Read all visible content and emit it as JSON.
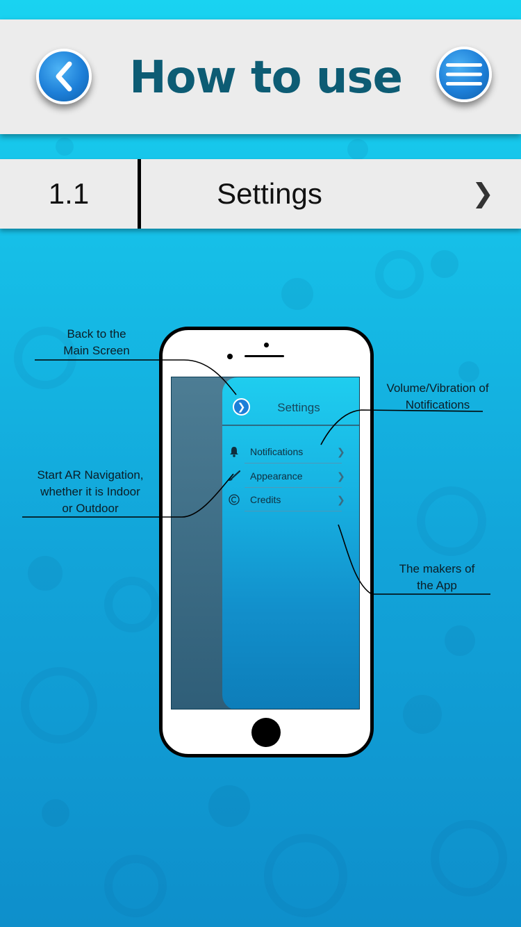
{
  "header": {
    "title": "How to use",
    "back_icon": "chevron-left-icon",
    "menu_icon": "hamburger-menu-icon"
  },
  "section": {
    "number": "1.1",
    "title": "Settings",
    "chevron": "❯"
  },
  "phone_screen": {
    "back_glyph": "❯",
    "title": "Settings",
    "items": [
      {
        "label": "Notifications",
        "icon": "bell-icon",
        "chevron": "❯"
      },
      {
        "label": "Appearance",
        "icon": "brush-icon",
        "chevron": "❯"
      },
      {
        "label": "Credits",
        "icon": "copyright-icon",
        "chevron": "❯"
      }
    ]
  },
  "callouts": {
    "back": [
      "Back to the",
      "Main Screen"
    ],
    "volume": [
      "Volume/Vibration of",
      "Notifications"
    ],
    "ar": [
      "Start AR Navigation,",
      "whether it is Indoor",
      "or Outdoor"
    ],
    "makers": [
      "The makers of",
      "the App"
    ]
  },
  "colors": {
    "title": "#0d5c74",
    "background_top": "#19d3f1",
    "background_bottom": "#0e8fcb",
    "bar": "#ececec",
    "button": "#1d7fd8"
  }
}
